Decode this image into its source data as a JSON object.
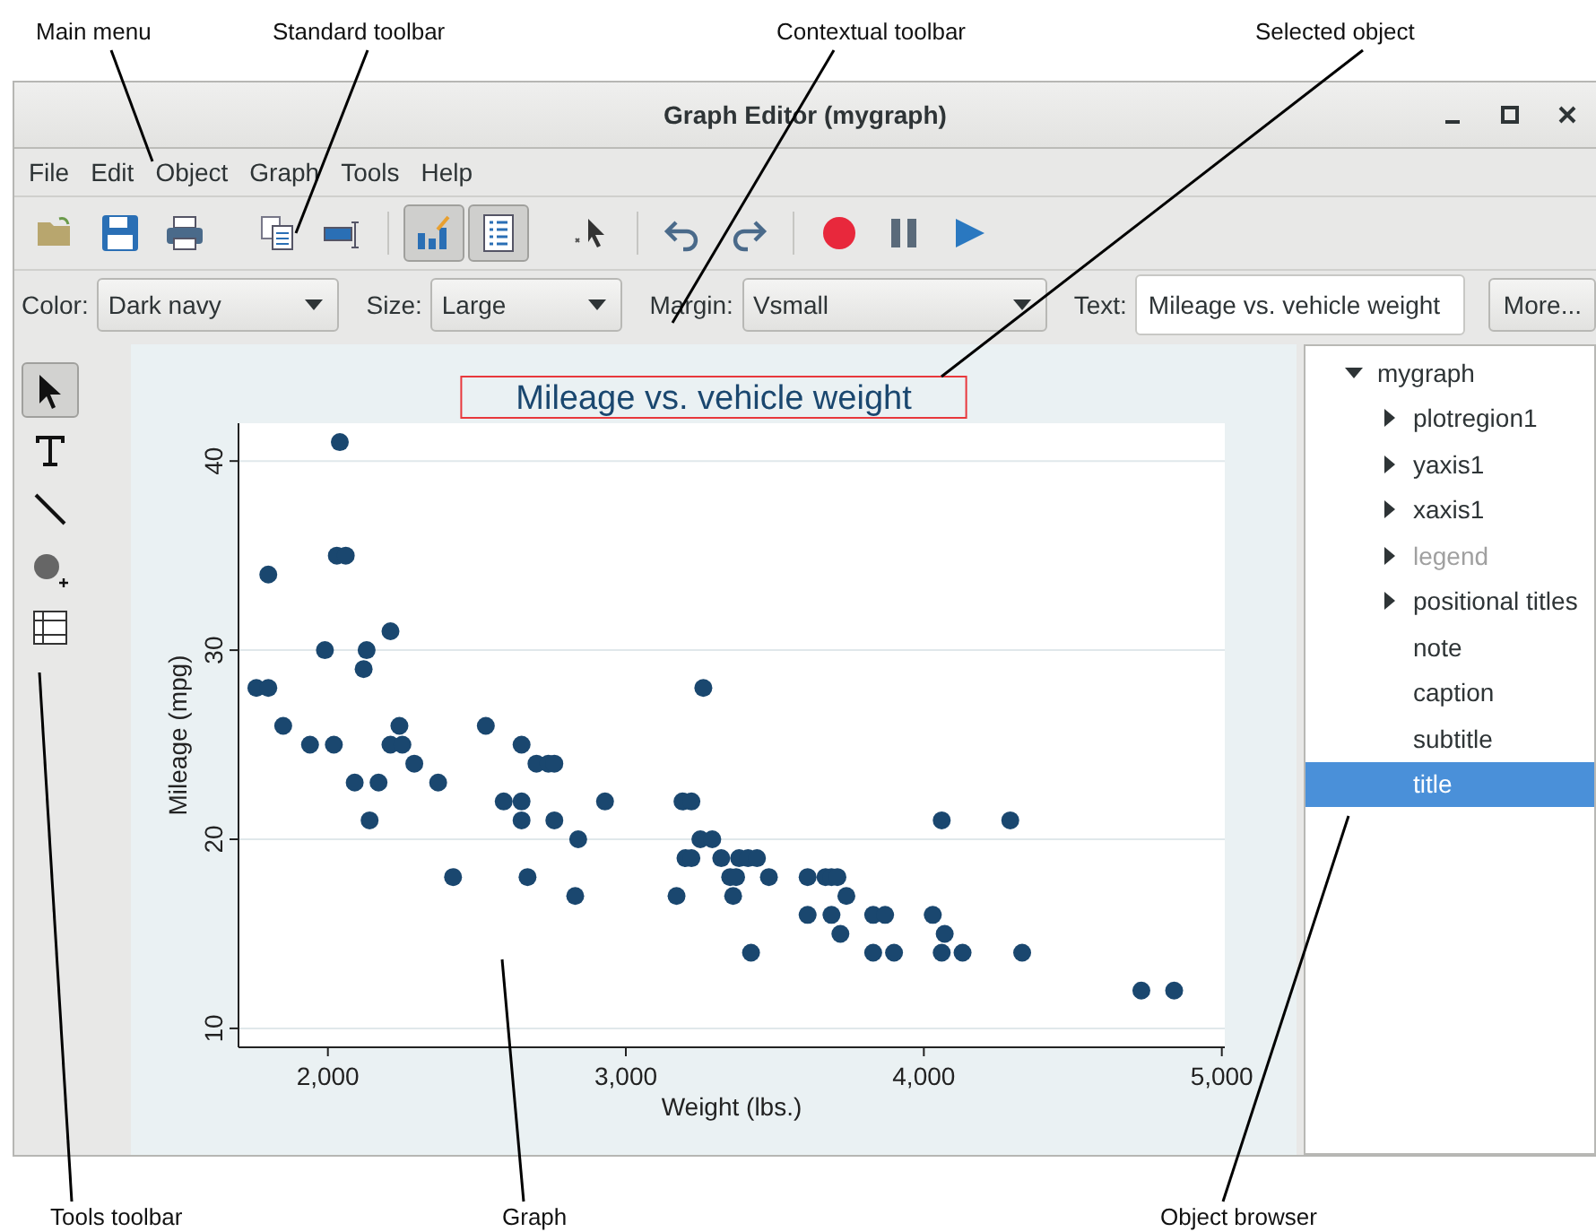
{
  "callouts": [
    "Main menu",
    "Standard toolbar",
    "Contextual toolbar",
    "Selected object",
    "Tools toolbar",
    "Graph",
    "Object browser"
  ],
  "window": {
    "title": "Graph Editor (mygraph)"
  },
  "menu": [
    "File",
    "Edit",
    "Object",
    "Graph",
    "Tools",
    "Help"
  ],
  "standard_toolbar": [
    [
      {
        "kind": "open",
        "pressed": false
      },
      {
        "kind": "save",
        "pressed": false
      },
      {
        "kind": "print",
        "pressed": false
      },
      {
        "kind": "copy",
        "pressed": false
      },
      {
        "kind": "rename",
        "pressed": false
      }
    ],
    [
      {
        "kind": "graph",
        "pressed": true
      },
      {
        "kind": "browser",
        "pressed": true
      },
      {
        "kind": "pointer",
        "pressed": false
      }
    ],
    [
      {
        "kind": "undo",
        "pressed": false
      },
      {
        "kind": "redo",
        "pressed": false
      }
    ],
    [
      {
        "kind": "record",
        "pressed": false
      },
      {
        "kind": "pause",
        "pressed": false
      },
      {
        "kind": "play",
        "pressed": false
      }
    ]
  ],
  "contextual_toolbar": {
    "fields": [
      {
        "kind": "dropdown",
        "label": "Color:",
        "value": "Dark navy"
      },
      {
        "kind": "dropdown",
        "label": "Size:",
        "value": "Large"
      },
      {
        "kind": "dropdown",
        "label": "Margin:",
        "value": "Vsmall"
      },
      {
        "kind": "text",
        "label": "Text:",
        "value": "Mileage vs. vehicle weight"
      }
    ],
    "button": "More..."
  },
  "tools": [
    {
      "kind": "pointer",
      "selected": true
    },
    {
      "kind": "text",
      "selected": false
    },
    {
      "kind": "line",
      "selected": false
    },
    {
      "kind": "marker",
      "selected": false
    },
    {
      "kind": "grid",
      "selected": false
    }
  ],
  "graph": {
    "title": "Mileage vs. vehicle weight",
    "title_selected": true,
    "chart_data": {
      "type": "scatter",
      "xlabel": "Weight (lbs.)",
      "ylabel": "Mileage (mpg)",
      "xlim": [
        1700,
        5010
      ],
      "ylim": [
        9,
        42
      ],
      "grid": true,
      "xticks": [
        {
          "value": 2000,
          "label": "2,000"
        },
        {
          "value": 3000,
          "label": "3,000"
        },
        {
          "value": 4000,
          "label": "4,000"
        },
        {
          "value": 5000,
          "label": "5,000"
        }
      ],
      "yticks": [
        10,
        20,
        30,
        40
      ],
      "series": [
        {
          "color": "#1a476f",
          "x": [
            2040,
            1800,
            1760,
            1800,
            1850,
            1940,
            2020,
            1990,
            2030,
            2060,
            2130,
            2120,
            2210,
            2090,
            2170,
            2140,
            2210,
            2250,
            2240,
            2290,
            2370,
            2420,
            2530,
            2590,
            2650,
            2650,
            2700,
            2740,
            2760,
            2650,
            2760,
            2670,
            2840,
            2830,
            2930,
            3170,
            3190,
            3220,
            3200,
            3220,
            3260,
            3250,
            3290,
            3320,
            3350,
            3360,
            3380,
            3410,
            3440,
            3370,
            3480,
            3420,
            3610,
            3610,
            3670,
            3690,
            3710,
            3690,
            3720,
            3740,
            3830,
            3830,
            3900,
            3870,
            4060,
            4030,
            4070,
            4060,
            4130,
            4290,
            4330,
            4730,
            4840
          ],
          "values": [
            41,
            34,
            28,
            28,
            26,
            25,
            25,
            30,
            35,
            35,
            30,
            29,
            31,
            23,
            23,
            21,
            25,
            25,
            26,
            24,
            23,
            18,
            26,
            22,
            22,
            25,
            24,
            24,
            24,
            21,
            21,
            18,
            20,
            17,
            22,
            17,
            22,
            22,
            19,
            19,
            28,
            20,
            20,
            19,
            18,
            17,
            19,
            19,
            19,
            18,
            18,
            14,
            18,
            16,
            18,
            18,
            18,
            16,
            15,
            17,
            16,
            14,
            14,
            16,
            21,
            16,
            15,
            14,
            14,
            21,
            14,
            12,
            12
          ]
        }
      ]
    }
  },
  "object_browser": [
    {
      "label": "mygraph",
      "kind": "branch",
      "expanded": true,
      "disabled": false,
      "selected": false,
      "children": [
        {
          "label": "plotregion1",
          "kind": "branch",
          "expanded": false,
          "disabled": false,
          "selected": false
        },
        {
          "label": "yaxis1",
          "kind": "branch",
          "expanded": false,
          "disabled": false,
          "selected": false
        },
        {
          "label": "xaxis1",
          "kind": "branch",
          "expanded": false,
          "disabled": false,
          "selected": false
        },
        {
          "label": "legend",
          "kind": "branch",
          "expanded": false,
          "disabled": true,
          "selected": false
        },
        {
          "label": "positional titles",
          "kind": "branch",
          "expanded": false,
          "disabled": false,
          "selected": false
        },
        {
          "label": "note",
          "kind": "leaf",
          "disabled": false,
          "selected": false
        },
        {
          "label": "caption",
          "kind": "leaf",
          "disabled": false,
          "selected": false
        },
        {
          "label": "subtitle",
          "kind": "leaf",
          "disabled": false,
          "selected": false
        },
        {
          "label": "title",
          "kind": "leaf",
          "disabled": false,
          "selected": true
        }
      ]
    }
  ]
}
